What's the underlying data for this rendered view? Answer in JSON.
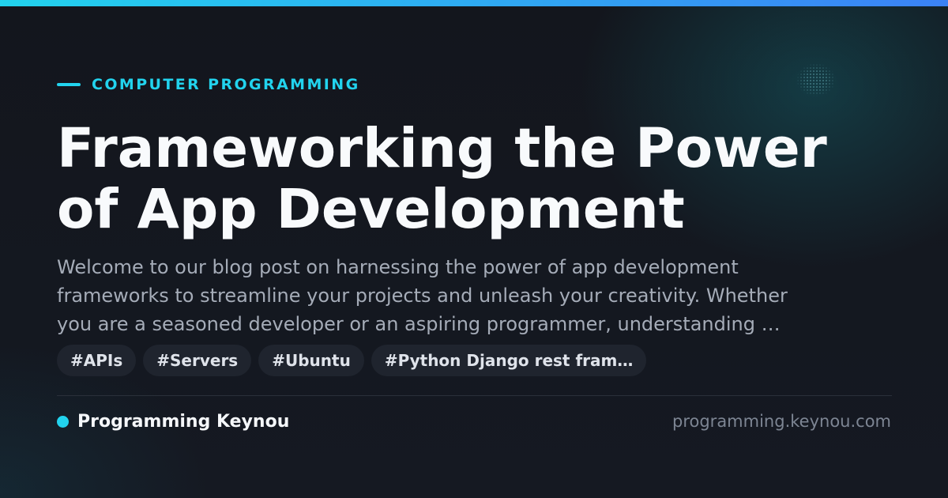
{
  "card": {
    "category": "COMPUTER PROGRAMMING",
    "title_lines": [
      "Frameworking the Power",
      "of App Development"
    ],
    "description_lines": [
      "Welcome to our blog post on harnessing the power of app development",
      "frameworks to streamline your projects and unleash your creativity. Whether",
      "you are a seasoned developer or an aspiring programmer, understanding …"
    ],
    "tags": [
      "#APIs",
      "#Servers",
      "#Ubuntu",
      "#Python Django rest fram…"
    ],
    "brand_name": "Programming Keynou",
    "domain": "programming.keynou.com"
  },
  "colors": {
    "accent": "#22d3ee",
    "accent_gradient_end": "#3b82f6",
    "background": "#13161d",
    "title": "#f8fafc",
    "description": "#a5acb8",
    "tag_background": "#1f242e",
    "domain": "#7d8593"
  },
  "icons": {
    "category_marker": "accent-dash",
    "brand_marker": "accent-dot"
  }
}
